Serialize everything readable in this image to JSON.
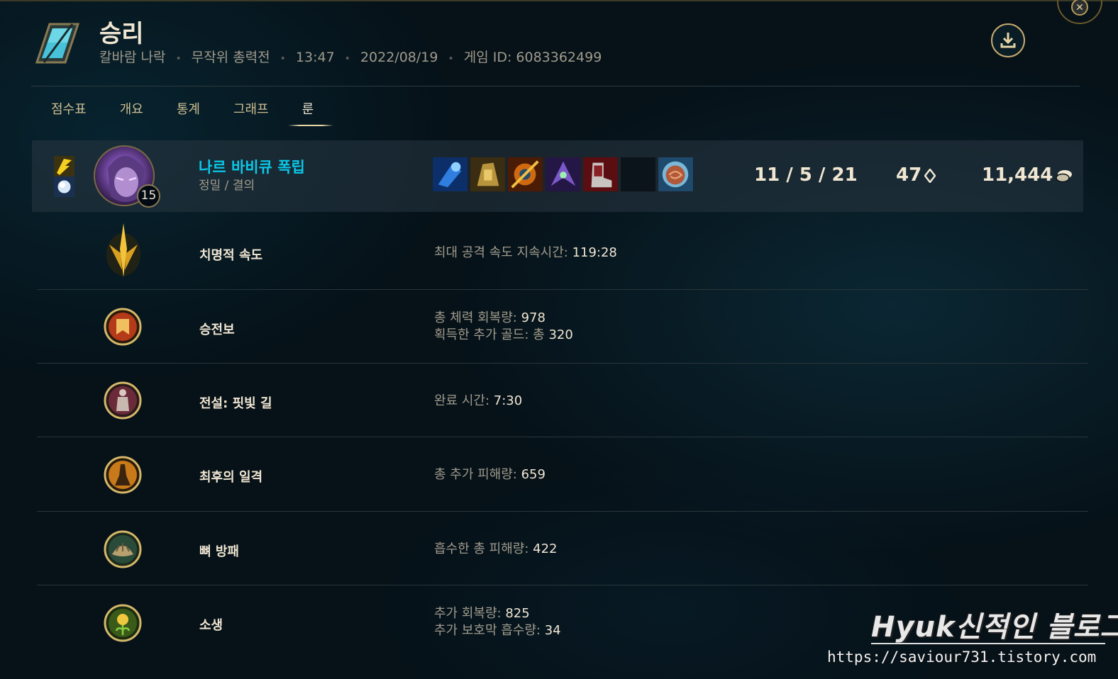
{
  "header": {
    "result_title": "승리",
    "map": "칼바람 나락",
    "queue": "무작위 총력전",
    "duration": "13:47",
    "date": "2022/08/19",
    "game_id": "게임 ID: 6083362499",
    "download_icon": "download-icon",
    "close_icon": "close-icon"
  },
  "tabs": [
    {
      "label": "점수표",
      "active": false
    },
    {
      "label": "개요",
      "active": false
    },
    {
      "label": "통계",
      "active": false
    },
    {
      "label": "그래프",
      "active": false
    },
    {
      "label": "룬",
      "active": true
    }
  ],
  "player": {
    "name": "나르 바비큐 폭립",
    "traits": "정밀 / 결의",
    "level": "15",
    "kda": "11 / 5 / 21",
    "cs": "47",
    "gold": "11,444",
    "items": [
      "item-blue",
      "item-gold",
      "item-orange",
      "item-purple",
      "item-red",
      "item-empty",
      "item-poro"
    ]
  },
  "runes": [
    {
      "name": "치명적 속도",
      "icon": "lethal-tempo-icon",
      "stats": [
        {
          "label": "최대 공격 속도 지속시간: ",
          "value": "119:28"
        }
      ]
    },
    {
      "name": "승전보",
      "icon": "triumph-icon",
      "stats": [
        {
          "label": "총 체력 회복량: ",
          "value": "978"
        },
        {
          "label": "획득한 추가 골드: 총 ",
          "value": "320"
        }
      ]
    },
    {
      "name": "전설: 핏빛 길",
      "icon": "legend-bloodline-icon",
      "stats": [
        {
          "label": "완료 시간: ",
          "value": "7:30"
        }
      ]
    },
    {
      "name": "최후의 일격",
      "icon": "last-stand-icon",
      "stats": [
        {
          "label": "총 추가 피해량: ",
          "value": "659"
        }
      ]
    },
    {
      "name": "뼈 방패",
      "icon": "bone-plating-icon",
      "stats": [
        {
          "label": "흡수한 총 피해량: ",
          "value": "422"
        }
      ]
    },
    {
      "name": "소생",
      "icon": "revitalize-icon",
      "stats": [
        {
          "label": "추가 회복량: ",
          "value": "825"
        },
        {
          "label": "추가 보호막 흡수량: ",
          "value": "34"
        }
      ]
    }
  ],
  "watermark": {
    "title": "Hyuk신적인 블로그",
    "url": "https://saviour731.tistory.com"
  },
  "colors": {
    "accent_gold": "#c8aa6e",
    "player_name": "#0ac8e8",
    "background": "#061118"
  }
}
